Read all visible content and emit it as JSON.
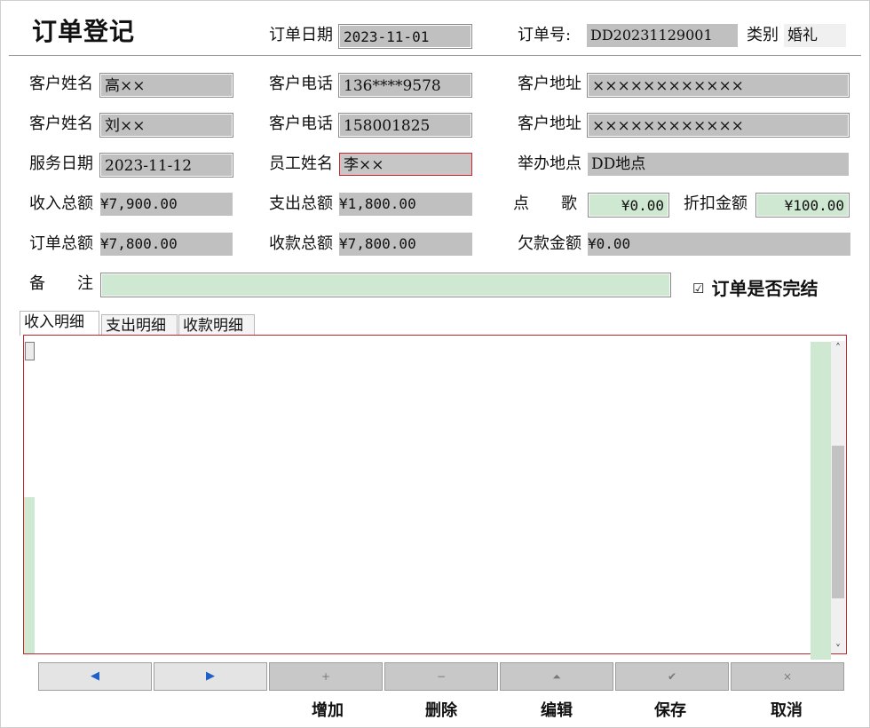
{
  "header": {
    "title": "订单登记",
    "order_date_label": "订单日期",
    "order_date": "2023-11-01",
    "order_no_label": "订单号:",
    "order_no": "DD20231129001",
    "category_label": "类别",
    "category": "婚礼"
  },
  "customers": [
    {
      "name_label": "客户姓名",
      "name": "高××",
      "phone_label": "客户电话",
      "phone": "136****9578",
      "addr_label": "客户地址",
      "addr": "××××××××××××"
    },
    {
      "name_label": "客户姓名",
      "name": "刘××",
      "phone_label": "客户电话",
      "phone": "158001825",
      "addr_label": "客户地址",
      "addr": "××××××××××××"
    }
  ],
  "service": {
    "date_label": "服务日期",
    "date": "2023-11-12",
    "staff_label": "员工姓名",
    "staff": "李××",
    "venue_label": "举办地点",
    "venue": "DD地点"
  },
  "amounts": {
    "income_label": "收入总额",
    "income": "¥7,900.00",
    "expense_label": "支出总额",
    "expense": "¥1,800.00",
    "song_label": "点　　歌",
    "song": "¥0.00",
    "discount_label": "折扣金额",
    "discount": "¥100.00",
    "order_total_label": "订单总额",
    "order_total": "¥7,800.00",
    "received_label": "收款总额",
    "received": "¥7,800.00",
    "owed_label": "欠款金额",
    "owed": "¥0.00"
  },
  "remark": {
    "label": "备　　注",
    "value": ""
  },
  "completed": {
    "label": "订单是否完结",
    "checked": true,
    "mark": "☑"
  },
  "tabs": [
    {
      "label": "收入明细",
      "active": true
    },
    {
      "label": "支出明细",
      "active": false
    },
    {
      "label": "收款明细",
      "active": false
    }
  ],
  "toolbar": {
    "prev_glyph": "◀",
    "next_glyph": "▶",
    "add_glyph": "+",
    "delete_glyph": "−",
    "edit_glyph": "⏶",
    "save_glyph": "✔",
    "cancel_glyph": "×",
    "add": "增加",
    "delete": "删除",
    "edit": "编辑",
    "save": "保存",
    "cancel": "取消"
  },
  "scroll": {
    "up": "˄",
    "down": "˅"
  },
  "colors": {
    "accent_red": "#c0282c",
    "field_gray": "#c0c0c0",
    "field_green": "#cfe8d2",
    "nav_blue": "#1f5fc9"
  }
}
